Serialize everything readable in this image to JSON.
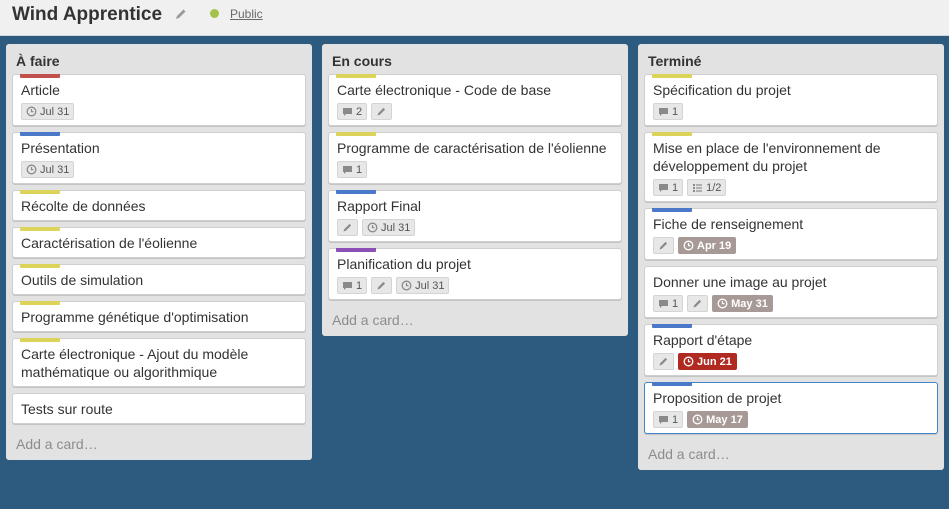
{
  "board": {
    "title": "Wind Apprentice",
    "visibility": "Public"
  },
  "colors": {
    "background": "#2c5b7f",
    "label_red": "#c0504d",
    "label_blue": "#4a79c9",
    "label_yellow": "#dbd35a",
    "label_purple": "#8c4fb5",
    "due_soon": "#a79a96",
    "due_now": "#b12a21"
  },
  "lists": [
    {
      "title": "À faire",
      "add_card": "Add a card…",
      "cards": [
        {
          "title": "Article",
          "label": "red",
          "badges": [
            {
              "icon": "clock-icon",
              "text": "Jul 31",
              "kind": "due"
            }
          ]
        },
        {
          "title": "Présentation",
          "label": "blue",
          "badges": [
            {
              "icon": "clock-icon",
              "text": "Jul 31",
              "kind": "due"
            }
          ]
        },
        {
          "title": "Récolte de données",
          "label": "yellow",
          "badges": []
        },
        {
          "title": "Caractérisation de l'éolienne",
          "label": "yellow",
          "badges": []
        },
        {
          "title": "Outils de simulation",
          "label": "yellow",
          "badges": []
        },
        {
          "title": "Programme génétique d'optimisation",
          "label": "yellow",
          "badges": []
        },
        {
          "title": "Carte électronique - Ajout du modèle mathématique ou algorithmique",
          "label": "yellow",
          "badges": []
        },
        {
          "title": "Tests sur route",
          "label": "",
          "badges": []
        }
      ]
    },
    {
      "title": "En cours",
      "add_card": "Add a card…",
      "cards": [
        {
          "title": "Carte électronique - Code de base",
          "label": "yellow",
          "badges": [
            {
              "icon": "comment-icon",
              "text": "2",
              "kind": "plain"
            },
            {
              "icon": "pencil-icon",
              "text": "",
              "kind": "plain"
            }
          ]
        },
        {
          "title": "Programme de caractérisation de l'éolienne",
          "label": "yellow",
          "badges": [
            {
              "icon": "comment-icon",
              "text": "1",
              "kind": "plain"
            }
          ]
        },
        {
          "title": "Rapport Final",
          "label": "blue",
          "badges": [
            {
              "icon": "pencil-icon",
              "text": "",
              "kind": "plain"
            },
            {
              "icon": "clock-icon",
              "text": "Jul 31",
              "kind": "due"
            }
          ]
        },
        {
          "title": "Planification du projet",
          "label": "purple",
          "badges": [
            {
              "icon": "comment-icon",
              "text": "1",
              "kind": "plain"
            },
            {
              "icon": "pencil-icon",
              "text": "",
              "kind": "plain"
            },
            {
              "icon": "clock-icon",
              "text": "Jul 31",
              "kind": "due"
            }
          ]
        }
      ]
    },
    {
      "title": "Terminé",
      "add_card": "Add a card…",
      "cards": [
        {
          "title": "Spécification du projet",
          "label": "yellow",
          "badges": [
            {
              "icon": "comment-icon",
              "text": "1",
              "kind": "plain"
            }
          ]
        },
        {
          "title": "Mise en place de l'environnement de développement du projet",
          "label": "yellow",
          "badges": [
            {
              "icon": "comment-icon",
              "text": "1",
              "kind": "plain"
            },
            {
              "icon": "checklist-icon",
              "text": "1/2",
              "kind": "plain"
            }
          ]
        },
        {
          "title": "Fiche de renseignement",
          "label": "blue",
          "badges": [
            {
              "icon": "pencil-icon",
              "text": "",
              "kind": "plain"
            },
            {
              "icon": "clock-icon",
              "text": "Apr 19",
              "kind": "due-soon"
            }
          ]
        },
        {
          "title": "Donner une image au projet",
          "label": "",
          "badges": [
            {
              "icon": "comment-icon",
              "text": "1",
              "kind": "plain"
            },
            {
              "icon": "pencil-icon",
              "text": "",
              "kind": "plain"
            },
            {
              "icon": "clock-icon",
              "text": "May 31",
              "kind": "due-soon"
            }
          ]
        },
        {
          "title": "Rapport d'étape",
          "label": "blue",
          "badges": [
            {
              "icon": "pencil-icon",
              "text": "",
              "kind": "plain"
            },
            {
              "icon": "clock-icon",
              "text": "Jun 21",
              "kind": "due-now"
            }
          ]
        },
        {
          "title": "Proposition de projet",
          "label": "blue",
          "badges": [
            {
              "icon": "comment-icon",
              "text": "1",
              "kind": "plain"
            },
            {
              "icon": "clock-icon",
              "text": "May 17",
              "kind": "due-soon"
            }
          ],
          "focused": true
        }
      ]
    }
  ]
}
